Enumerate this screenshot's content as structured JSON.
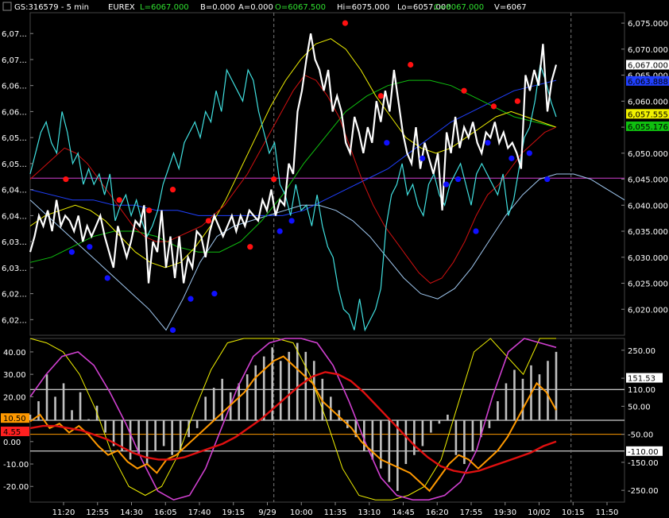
{
  "header": {
    "symbol": "GS:316579 - 5 min",
    "exchange": "EUREX",
    "last": "L=6067.000",
    "bid": "B=0.000",
    "ask": "A=0.000",
    "open": "O=6067.500",
    "high": "Hi=6075.000",
    "low": "Lo=6057.000",
    "close": "C=6067.000",
    "volume": "V=6067"
  },
  "colors": {
    "background": "#000000",
    "price": "#ffffff",
    "cyan": "#40e0e0",
    "red_ma": "#d01010",
    "yellow": "#f0f000",
    "green": "#10c010",
    "blue_ma": "#2040ff",
    "magenta": "#d040d0",
    "light_blue": "#a0c8f0",
    "orange": "#ff9900",
    "dot_red": "#ff1010",
    "dot_blue": "#1010ff",
    "axis_text": "#ffffff"
  },
  "chart_data": [
    {
      "type": "line",
      "panel": "price",
      "yaxis_right_ticks": [
        "6,075.000",
        "6,070.000",
        "6,065.000",
        "6,060.000",
        "6,055.000",
        "6,050.000",
        "6,045.000",
        "6,040.000",
        "6,035.000",
        "6,030.000",
        "6,025.000",
        "6,020.000"
      ],
      "yaxis_left_ticks": [
        "6,07...",
        "6,07...",
        "6,06...",
        "6,06...",
        "6,05...",
        "6,05...",
        "6,04...",
        "6,04...",
        "6,03...",
        "6,03...",
        "6,02...",
        "6,02..."
      ],
      "ylim": [
        6015,
        6077
      ],
      "right_tags": [
        {
          "label": "6,067.000",
          "value": 6067.0,
          "bg": "#ffffff",
          "fg": "#000000"
        },
        {
          "label": "6,063.888",
          "value": 6063.888,
          "bg": "#2040ff",
          "fg": "#000000"
        },
        {
          "label": "6,057.555",
          "value": 6057.555,
          "bg": "#f0f000",
          "fg": "#000000"
        },
        {
          "label": "6,055.176",
          "value": 6055.176,
          "bg": "#10c010",
          "fg": "#000000"
        }
      ],
      "hline": 6045.2,
      "series": [
        {
          "key": "price",
          "color": "#ffffff",
          "width": 2.2,
          "values": [
            6031,
            6034,
            6038,
            6036,
            6039,
            6035,
            6041,
            6036,
            6038,
            6037,
            6035,
            6038,
            6033,
            6036,
            6034,
            6036,
            6038,
            6034,
            6031,
            6028,
            6036,
            6033,
            6030,
            6033,
            6037,
            6036,
            6040,
            6025,
            6033,
            6031,
            6039,
            6028,
            6034,
            6026,
            6034,
            6025,
            6030,
            6028,
            6035,
            6034,
            6030,
            6035,
            6038,
            6036,
            6034,
            6036,
            6038,
            6035,
            6038,
            6036,
            6039,
            6038,
            6037,
            6041,
            6039,
            6043,
            6038,
            6041,
            6040,
            6048,
            6046,
            6058,
            6062,
            6068,
            6073,
            6068,
            6066,
            6062,
            6066,
            6058,
            6061,
            6058,
            6052,
            6050,
            6057,
            6054,
            6050,
            6055,
            6052,
            6060,
            6056,
            6062,
            6058,
            6066,
            6060,
            6054,
            6050,
            6048,
            6055,
            6047,
            6052,
            6049,
            6046,
            6050,
            6039,
            6054,
            6050,
            6057,
            6051,
            6055,
            6053,
            6056,
            6052,
            6050,
            6054,
            6053,
            6056,
            6052,
            6054,
            6051,
            6052,
            6050,
            6047,
            6065,
            6062,
            6066,
            6063,
            6071,
            6058,
            6064,
            6067
          ]
        },
        {
          "key": "cyan",
          "color": "#40e0e0",
          "width": 1.2,
          "values": [
            6046,
            6050,
            6054,
            6056,
            6052,
            6050,
            6058,
            6054,
            6048,
            6050,
            6044,
            6047,
            6044,
            6046,
            6042,
            6046,
            6037,
            6040,
            6042,
            6038,
            6041,
            6037,
            6034,
            6036,
            6039,
            6044,
            6047,
            6050,
            6047,
            6052,
            6054,
            6056,
            6053,
            6058,
            6056,
            6062,
            6058,
            6066,
            6064,
            6062,
            6060,
            6066,
            6064,
            6058,
            6054,
            6050,
            6052,
            6044,
            6042,
            6038,
            6044,
            6039,
            6040,
            6036,
            6042,
            6036,
            6032,
            6030,
            6024,
            6020,
            6019,
            6016,
            6022,
            6016,
            6018,
            6020,
            6024,
            6036,
            6042,
            6044,
            6048,
            6042,
            6044,
            6040,
            6038,
            6044,
            6046,
            6042,
            6040,
            6044,
            6046,
            6048,
            6044,
            6040,
            6046,
            6048,
            6046,
            6044,
            6042,
            6046,
            6038,
            6041,
            6047,
            6053,
            6055,
            6060,
            6067,
            6064,
            6060,
            6057
          ]
        },
        {
          "key": "red_ma",
          "color": "#d01010",
          "width": 1,
          "values": [
            6045,
            6047,
            6049,
            6051,
            6050,
            6048,
            6045,
            6042,
            6039,
            6036,
            6034,
            6033,
            6033,
            6034,
            6035,
            6036,
            6038,
            6040,
            6043,
            6046,
            6050,
            6054,
            6058,
            6062,
            6065,
            6064,
            6061,
            6057,
            6051,
            6045,
            6040,
            6036,
            6033,
            6030,
            6027,
            6025,
            6026,
            6029,
            6033,
            6038,
            6042,
            6044,
            6047,
            6050,
            6052,
            6054,
            6055
          ]
        },
        {
          "key": "yellow",
          "color": "#f0f000",
          "width": 1,
          "values": [
            6036,
            6038,
            6039,
            6040,
            6039,
            6037,
            6034,
            6031,
            6029,
            6028,
            6029,
            6032,
            6036,
            6041,
            6047,
            6053,
            6059,
            6064,
            6068,
            6071,
            6072,
            6070,
            6066,
            6061,
            6057,
            6053,
            6051,
            6050,
            6051,
            6053,
            6055,
            6057,
            6058,
            6057,
            6056,
            6055
          ]
        },
        {
          "key": "green",
          "color": "#10c010",
          "width": 1,
          "values": [
            6029,
            6030,
            6032,
            6034,
            6035,
            6035,
            6034,
            6032,
            6031,
            6031,
            6033,
            6037,
            6042,
            6048,
            6053,
            6058,
            6061,
            6063,
            6064,
            6064,
            6063,
            6061,
            6059,
            6057,
            6056,
            6055
          ]
        },
        {
          "key": "blue_ma",
          "color": "#2040ff",
          "width": 1,
          "values": [
            6043,
            6042,
            6041,
            6041,
            6040,
            6040,
            6039,
            6039,
            6038,
            6038,
            6038,
            6038,
            6038,
            6039,
            6041,
            6043,
            6045,
            6047,
            6050,
            6053,
            6056,
            6058,
            6060,
            6062,
            6063,
            6064
          ]
        },
        {
          "key": "light_blue",
          "color": "#a0c8f0",
          "width": 1,
          "values": [
            6041,
            6038,
            6035,
            6032,
            6029,
            6026,
            6023,
            6020,
            6016,
            6022,
            6029,
            6034,
            6036,
            6037,
            6038,
            6039,
            6040,
            6040,
            6039,
            6037,
            6034,
            6030,
            6026,
            6023,
            6022,
            6024,
            6028,
            6033,
            6038,
            6042,
            6045,
            6046,
            6046,
            6045,
            6043,
            6041
          ]
        }
      ],
      "dots_red": [
        [
          0.06,
          6045
        ],
        [
          0.15,
          6041
        ],
        [
          0.2,
          6039
        ],
        [
          0.24,
          6043
        ],
        [
          0.3,
          6037
        ],
        [
          0.37,
          6032
        ],
        [
          0.41,
          6045
        ],
        [
          0.53,
          6075
        ],
        [
          0.59,
          6061
        ],
        [
          0.64,
          6067
        ],
        [
          0.73,
          6062
        ],
        [
          0.78,
          6059
        ],
        [
          0.82,
          6060
        ]
      ],
      "dots_blue": [
        [
          0.07,
          6031
        ],
        [
          0.1,
          6032
        ],
        [
          0.13,
          6026
        ],
        [
          0.24,
          6016
        ],
        [
          0.27,
          6022
        ],
        [
          0.31,
          6023
        ],
        [
          0.42,
          6035
        ],
        [
          0.44,
          6037
        ],
        [
          0.6,
          6052
        ],
        [
          0.66,
          6049
        ],
        [
          0.7,
          6044
        ],
        [
          0.72,
          6045
        ],
        [
          0.75,
          6035
        ],
        [
          0.77,
          6052
        ],
        [
          0.81,
          6049
        ],
        [
          0.84,
          6050
        ],
        [
          0.87,
          6045
        ]
      ],
      "vertical_lines": [
        0.41,
        0.91
      ]
    },
    {
      "type": "bar",
      "panel": "oscillator",
      "yaxis_left_ticks": [
        "40.00",
        "30.00",
        "20.00",
        "10.00",
        "0.00",
        "-10.00",
        "-20.00"
      ],
      "yaxis_right_ticks": [
        "250.00",
        "150.00",
        "50.00",
        "-50.00",
        "-150.00",
        "-250.00"
      ],
      "ylim": [
        -27,
        46
      ],
      "right_tags": [
        {
          "label": "151.53",
          "value": 151.53,
          "bg": "#ffffff",
          "fg": "#000000"
        },
        {
          "label": "110.00",
          "value": 110.0,
          "bg": "#000000",
          "fg": "#ffffff"
        },
        {
          "label": "-110.00",
          "value": -110.0,
          "bg": "#ffffff",
          "fg": "#000000"
        }
      ],
      "left_tags": [
        {
          "label": "10.50",
          "value": 10.5,
          "bg": "#ff9900",
          "fg": "#000000"
        },
        {
          "label": "4.55",
          "value": 4.55,
          "bg": "#ff2020",
          "fg": "#000000"
        }
      ],
      "hlines_right_scale": [
        110,
        0,
        -50,
        -110
      ],
      "series": [
        {
          "key": "histogram",
          "color": "#c0c0c0",
          "width": 1,
          "values": [
            12,
            18,
            30,
            20,
            26,
            14,
            22,
            10,
            16,
            4,
            -2,
            -4,
            -8,
            -6,
            -10,
            -4,
            -2,
            -6,
            -4,
            2,
            6,
            20,
            24,
            28,
            22,
            26,
            30,
            34,
            38,
            42,
            36,
            40,
            44,
            40,
            36,
            28,
            20,
            14,
            6,
            2,
            -4,
            -8,
            -12,
            -18,
            -22,
            -10,
            -6,
            -2,
            4,
            8,
            12,
            -6,
            -10,
            -4,
            2,
            6,
            18,
            26,
            32,
            28,
            34,
            30,
            36,
            40
          ]
        },
        {
          "key": "orange",
          "color": "#ff9900",
          "width": 2,
          "values": [
            9,
            12,
            6,
            8,
            4,
            7,
            3,
            -2,
            -6,
            -4,
            -9,
            -12,
            -10,
            -14,
            -8,
            -6,
            -2,
            2,
            6,
            10,
            14,
            18,
            22,
            28,
            32,
            36,
            38,
            34,
            30,
            26,
            18,
            14,
            10,
            6,
            0,
            -4,
            -8,
            -10,
            -12,
            -14,
            -18,
            -22,
            -16,
            -10,
            -6,
            -8,
            -12,
            -8,
            -4,
            2,
            10,
            18,
            26,
            22,
            14
          ]
        },
        {
          "key": "red_thick",
          "color": "#e01010",
          "width": 2.4,
          "values": [
            6,
            7,
            7,
            6,
            5,
            3,
            1,
            -2,
            -5,
            -7,
            -8,
            -8,
            -7,
            -5,
            -3,
            -1,
            2,
            6,
            10,
            15,
            20,
            25,
            29,
            31,
            30,
            27,
            22,
            16,
            10,
            4,
            -2,
            -7,
            -11,
            -13,
            -14,
            -13,
            -11,
            -9,
            -7,
            -5,
            -2,
            0
          ]
        },
        {
          "key": "yellow",
          "color": "#f0f000",
          "width": 1,
          "values": [
            46,
            44,
            40,
            30,
            14,
            -6,
            -20,
            -24,
            -20,
            -6,
            14,
            32,
            44,
            46,
            46,
            46,
            44,
            30,
            10,
            -12,
            -24,
            -26,
            -26,
            -24,
            -20,
            -8,
            16,
            40,
            46,
            38,
            30,
            46,
            46
          ]
        },
        {
          "key": "magenta",
          "color": "#d040d0",
          "width": 1.6,
          "values": [
            20,
            30,
            38,
            40,
            34,
            22,
            8,
            -8,
            -22,
            -26,
            -24,
            -12,
            6,
            24,
            38,
            44,
            46,
            46,
            44,
            34,
            18,
            0,
            -16,
            -24,
            -26,
            -26,
            -24,
            -18,
            -4,
            20,
            40,
            46,
            44,
            42
          ]
        }
      ],
      "vertical_lines": [
        0.41,
        0.91
      ]
    }
  ],
  "xaxis": {
    "labels": [
      "11:20",
      "12:55",
      "14:30",
      "16:05",
      "17:40",
      "19:15",
      "9/29",
      "10:00",
      "11:35",
      "13:10",
      "14:45",
      "16:20",
      "17:55",
      "19:30",
      "10/02",
      "10:15",
      "11:50"
    ]
  }
}
